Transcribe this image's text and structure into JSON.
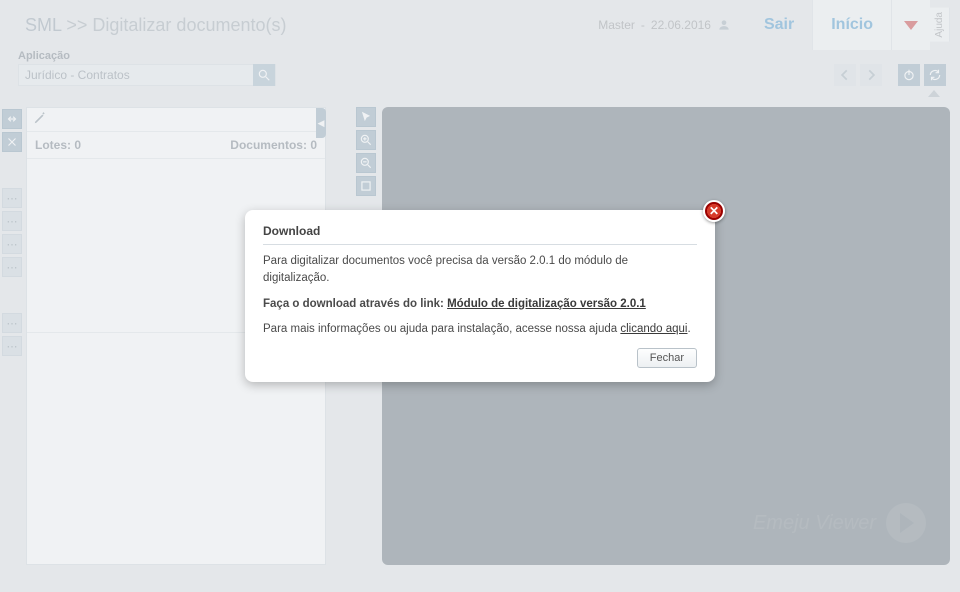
{
  "header": {
    "app_abbrev": "SML",
    "separator": ">>",
    "page_title": "Digitalizar documento(s)",
    "user_label": "Master",
    "date": "22.06.2016",
    "logout": "Sair",
    "home": "Início",
    "help": "Ajuda"
  },
  "subhead": {
    "label": "Aplicação",
    "selected_app": "Jurídico - Contratos"
  },
  "lotes": {
    "lotes_label": "Lotes:",
    "lotes_count": "0",
    "docs_label": "Documentos:",
    "docs_count": "0"
  },
  "viewer": {
    "watermark": "Emeju Viewer"
  },
  "modal": {
    "title": "Download",
    "line1": "Para digitalizar documentos você precisa da versão 2.0.1 do módulo de digitalização.",
    "line2_prefix": "Faça o download através do link:",
    "link1": "Módulo de digitalização versão 2.0.1",
    "line3_prefix": "Para mais informações ou ajuda para instalação, acesse nossa ajuda",
    "link2": "clicando aqui",
    "period": ".",
    "close_btn": "Fechar"
  },
  "icons": {
    "search": "search-icon",
    "power": "power-icon",
    "sync": "sync-icon",
    "left": "chevron-left-icon",
    "right": "chevron-right-icon",
    "pencil": "pencil-icon",
    "pointer": "pointer-icon",
    "zoomin": "zoom-in-icon",
    "zoomout": "zoom-out-icon",
    "fit": "fit-icon",
    "rotate": "rotate-icon",
    "crop": "crop-icon"
  }
}
